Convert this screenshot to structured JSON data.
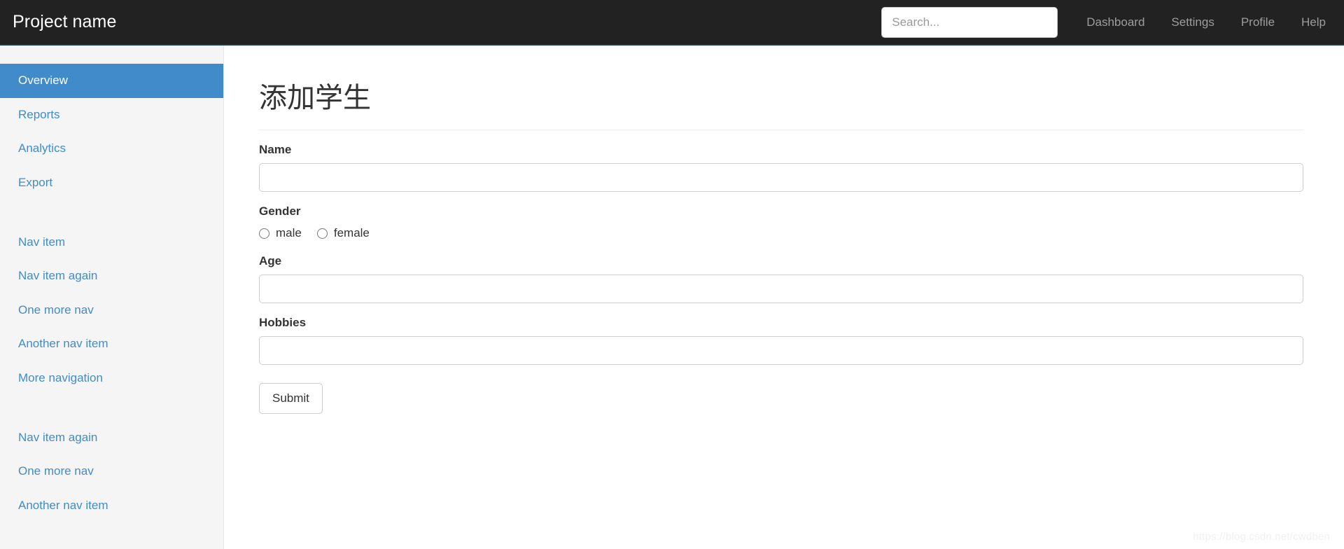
{
  "navbar": {
    "brand": "Project name",
    "search": {
      "value": "",
      "placeholder": "Search..."
    },
    "links": [
      {
        "label": "Dashboard"
      },
      {
        "label": "Settings"
      },
      {
        "label": "Profile"
      },
      {
        "label": "Help"
      }
    ],
    "colors": {
      "background": "#222222",
      "link": "#9d9d9d",
      "brand_text": "#ffffff"
    }
  },
  "sidebar": {
    "background": "#f5f5f5",
    "active_color": "#428bca",
    "link_color": "#428bca",
    "groups": [
      {
        "items": [
          {
            "label": "Overview",
            "active": true
          },
          {
            "label": "Reports",
            "active": false
          },
          {
            "label": "Analytics",
            "active": false
          },
          {
            "label": "Export",
            "active": false
          }
        ]
      },
      {
        "items": [
          {
            "label": "Nav item",
            "active": false
          },
          {
            "label": "Nav item again",
            "active": false
          },
          {
            "label": "One more nav",
            "active": false
          },
          {
            "label": "Another nav item",
            "active": false
          },
          {
            "label": "More navigation",
            "active": false
          }
        ]
      },
      {
        "items": [
          {
            "label": "Nav item again",
            "active": false
          },
          {
            "label": "One more nav",
            "active": false
          },
          {
            "label": "Another nav item",
            "active": false
          }
        ]
      }
    ]
  },
  "main": {
    "title": "添加学生",
    "form": {
      "name": {
        "label": "Name",
        "value": "",
        "placeholder": ""
      },
      "gender": {
        "label": "Gender",
        "options": [
          {
            "label": "male",
            "value": "male",
            "checked": false
          },
          {
            "label": "female",
            "value": "female",
            "checked": false
          }
        ]
      },
      "age": {
        "label": "Age",
        "value": "",
        "placeholder": ""
      },
      "hobbies": {
        "label": "Hobbies",
        "value": "",
        "placeholder": ""
      },
      "submit_label": "Submit"
    }
  },
  "watermark": {
    "text": "https://blog.csdn.net/cwdben"
  }
}
